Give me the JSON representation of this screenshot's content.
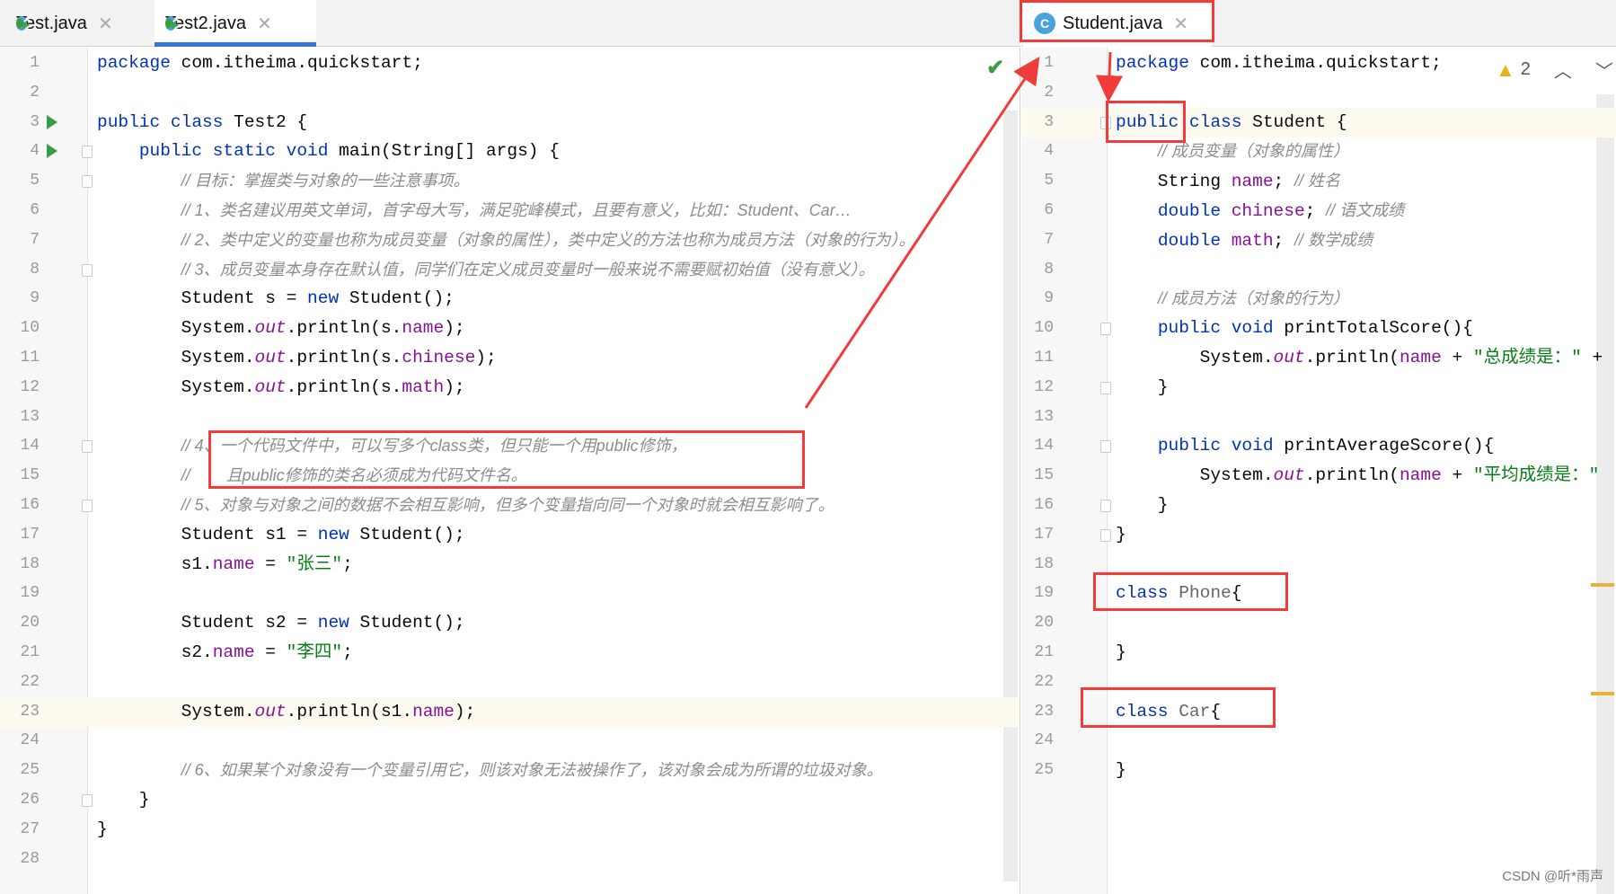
{
  "left": {
    "tabs": [
      {
        "label": "Test.java",
        "icon": "java-class-run-icon",
        "active": false
      },
      {
        "label": "Test2.java",
        "icon": "java-class-run-icon",
        "active": true
      }
    ],
    "status_icon": "checkmark-icon",
    "run_lines": [
      3,
      4
    ],
    "fold_lines": [
      4,
      5,
      8,
      14,
      16,
      26
    ],
    "current_line": 23,
    "lines": [
      [
        [
          "k",
          "package"
        ],
        [
          "p",
          " com.itheima.quickstart;"
        ]
      ],
      [],
      [
        [
          "k",
          "public class"
        ],
        [
          "p",
          " Test2 {"
        ]
      ],
      [
        [
          "p",
          "    "
        ],
        [
          "k",
          "public static void"
        ],
        [
          "p",
          " main(String[] args) {"
        ]
      ],
      [
        [
          "p",
          "        "
        ],
        [
          "c",
          "// 目标：掌握类与对象的一些注意事项。"
        ]
      ],
      [
        [
          "p",
          "        "
        ],
        [
          "c",
          "// 1、类名建议用英文单词，首字母大写，满足驼峰模式，且要有意义，比如：Student、Car…"
        ]
      ],
      [
        [
          "p",
          "        "
        ],
        [
          "c",
          "// 2、类中定义的变量也称为成员变量（对象的属性），类中定义的方法也称为成员方法（对象的行为）。"
        ]
      ],
      [
        [
          "p",
          "        "
        ],
        [
          "c",
          "// 3、成员变量本身存在默认值，同学们在定义成员变量时一般来说不需要赋初始值（没有意义）。"
        ]
      ],
      [
        [
          "p",
          "        Student s = "
        ],
        [
          "k",
          "new"
        ],
        [
          "p",
          " Student();"
        ]
      ],
      [
        [
          "p",
          "        System."
        ],
        [
          "o",
          "out"
        ],
        [
          "p",
          ".println(s."
        ],
        [
          "f",
          "name"
        ],
        [
          "p",
          ");"
        ]
      ],
      [
        [
          "p",
          "        System."
        ],
        [
          "o",
          "out"
        ],
        [
          "p",
          ".println(s."
        ],
        [
          "f",
          "chinese"
        ],
        [
          "p",
          ");"
        ]
      ],
      [
        [
          "p",
          "        System."
        ],
        [
          "o",
          "out"
        ],
        [
          "p",
          ".println(s."
        ],
        [
          "f",
          "math"
        ],
        [
          "p",
          ");"
        ]
      ],
      [],
      [
        [
          "p",
          "        "
        ],
        [
          "c",
          "// 4、一个代码文件中，可以写多个class类，但只能一个用public修饰，"
        ]
      ],
      [
        [
          "p",
          "        "
        ],
        [
          "c",
          "//        且public修饰的类名必须成为代码文件名。"
        ]
      ],
      [
        [
          "p",
          "        "
        ],
        [
          "c",
          "// 5、对象与对象之间的数据不会相互影响，但多个变量指向同一个对象时就会相互影响了。"
        ]
      ],
      [
        [
          "p",
          "        Student s1 = "
        ],
        [
          "k",
          "new"
        ],
        [
          "p",
          " Student();"
        ]
      ],
      [
        [
          "p",
          "        s1."
        ],
        [
          "f",
          "name"
        ],
        [
          "p",
          " = "
        ],
        [
          "s",
          "\"张三\""
        ],
        [
          "p",
          ";"
        ]
      ],
      [],
      [
        [
          "p",
          "        Student s2 = "
        ],
        [
          "k",
          "new"
        ],
        [
          "p",
          " Student();"
        ]
      ],
      [
        [
          "p",
          "        s2."
        ],
        [
          "f",
          "name"
        ],
        [
          "p",
          " = "
        ],
        [
          "s",
          "\"李四\""
        ],
        [
          "p",
          ";"
        ]
      ],
      [],
      [
        [
          "p",
          "        System."
        ],
        [
          "o",
          "out"
        ],
        [
          "p",
          ".println(s1."
        ],
        [
          "f",
          "name"
        ],
        [
          "p",
          ");"
        ]
      ],
      [],
      [
        [
          "p",
          "        "
        ],
        [
          "c",
          "// 6、如果某个对象没有一个变量引用它，则该对象无法被操作了，该对象会成为所谓的垃圾对象。"
        ]
      ],
      [
        [
          "p",
          "    }"
        ]
      ],
      [
        [
          "p",
          "}"
        ]
      ],
      []
    ]
  },
  "right": {
    "tabs": [
      {
        "label": "Student.java",
        "icon": "java-class-icon",
        "active": true
      }
    ],
    "warnings": {
      "icon": "warning-icon",
      "count": "2",
      "prev_icon": "chevron-up-icon",
      "next_icon": "chevron-down-icon"
    },
    "fold_lines": [
      3,
      10,
      12,
      14,
      16,
      17
    ],
    "current_line": 3,
    "lines": [
      [
        [
          "k",
          "package"
        ],
        [
          "p",
          " com.itheima.quickstart;"
        ]
      ],
      [],
      [
        [
          "k",
          "public"
        ],
        [
          "p",
          " "
        ],
        [
          "k",
          "class"
        ],
        [
          "p",
          " Student {"
        ]
      ],
      [
        [
          "p",
          "    "
        ],
        [
          "c",
          "// 成员变量（对象的属性）"
        ]
      ],
      [
        [
          "p",
          "    String "
        ],
        [
          "f",
          "name"
        ],
        [
          "p",
          "; "
        ],
        [
          "c",
          "// 姓名"
        ]
      ],
      [
        [
          "p",
          "    "
        ],
        [
          "k",
          "double"
        ],
        [
          "p",
          " "
        ],
        [
          "f",
          "chinese"
        ],
        [
          "p",
          "; "
        ],
        [
          "c",
          "// 语文成绩"
        ]
      ],
      [
        [
          "p",
          "    "
        ],
        [
          "k",
          "double"
        ],
        [
          "p",
          " "
        ],
        [
          "f",
          "math"
        ],
        [
          "p",
          "; "
        ],
        [
          "c",
          "// 数学成绩"
        ]
      ],
      [],
      [
        [
          "p",
          "    "
        ],
        [
          "c",
          "// 成员方法（对象的行为）"
        ]
      ],
      [
        [
          "p",
          "    "
        ],
        [
          "k",
          "public void"
        ],
        [
          "p",
          " printTotalScore(){"
        ]
      ],
      [
        [
          "p",
          "        System."
        ],
        [
          "o",
          "out"
        ],
        [
          "p",
          ".println("
        ],
        [
          "f",
          "name"
        ],
        [
          "p",
          " + "
        ],
        [
          "s",
          "\"总成绩是：\""
        ],
        [
          "p",
          " +"
        ]
      ],
      [
        [
          "p",
          "    }"
        ]
      ],
      [],
      [
        [
          "p",
          "    "
        ],
        [
          "k",
          "public void"
        ],
        [
          "p",
          " printAverageScore(){"
        ]
      ],
      [
        [
          "p",
          "        System."
        ],
        [
          "o",
          "out"
        ],
        [
          "p",
          ".println("
        ],
        [
          "f",
          "name"
        ],
        [
          "p",
          " + "
        ],
        [
          "s",
          "\"平均成绩是：\""
        ]
      ],
      [
        [
          "p",
          "    }"
        ]
      ],
      [
        [
          "p",
          "}"
        ]
      ],
      [],
      [
        [
          "k",
          "class"
        ],
        [
          "p",
          " "
        ],
        [
          "u",
          "Phone"
        ],
        [
          "p",
          "{"
        ]
      ],
      [],
      [
        [
          "p",
          "}"
        ]
      ],
      [],
      [
        [
          "k",
          "class"
        ],
        [
          "p",
          " "
        ],
        [
          "u",
          "Car"
        ],
        [
          "p",
          "{"
        ]
      ],
      [],
      [
        [
          "p",
          "}"
        ]
      ]
    ]
  },
  "colors": {
    "keyword": "#0033b3",
    "field": "#871094",
    "string": "#067d17",
    "comment": "#8c8c8c",
    "annotation": "#f23b3b",
    "tab_underline": "#3874d8"
  },
  "watermark": "CSDN @听*雨声"
}
